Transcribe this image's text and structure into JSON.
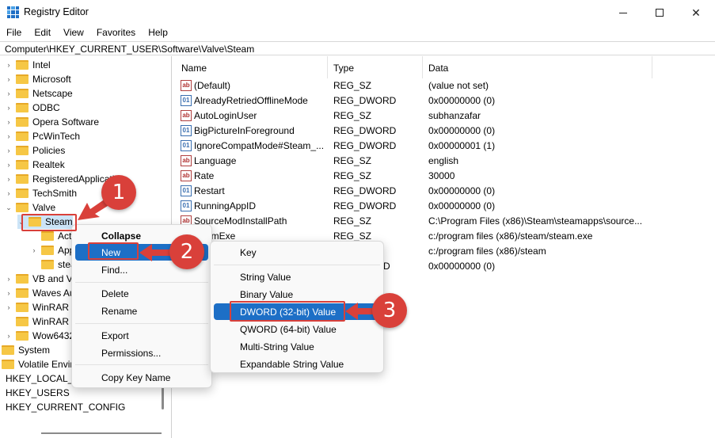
{
  "window": {
    "title": "Registry Editor",
    "minimize_icon": "minimize-icon",
    "maximize_icon": "maximize-icon",
    "close_label": "✕"
  },
  "menu": [
    "File",
    "Edit",
    "View",
    "Favorites",
    "Help"
  ],
  "address": "Computer\\HKEY_CURRENT_USER\\Software\\Valve\\Steam",
  "tree": [
    {
      "label": "Intel",
      "chevron": "›"
    },
    {
      "label": "Microsoft",
      "chevron": "›"
    },
    {
      "label": "Netscape",
      "chevron": "›"
    },
    {
      "label": "ODBC",
      "chevron": "›"
    },
    {
      "label": "Opera Software",
      "chevron": "›"
    },
    {
      "label": "PcWinTech",
      "chevron": "›"
    },
    {
      "label": "Policies",
      "chevron": "›"
    },
    {
      "label": "Realtek",
      "chevron": "›"
    },
    {
      "label": "RegisteredApplicatio",
      "chevron": "›"
    },
    {
      "label": "TechSmith",
      "chevron": "›"
    },
    {
      "label": "Valve",
      "chevron": "⌄"
    },
    {
      "label": "Steam",
      "chevron": "⌄"
    },
    {
      "label": "Act",
      "chevron": ""
    },
    {
      "label": "App",
      "chevron": "›"
    },
    {
      "label": "stea",
      "chevron": ""
    },
    {
      "label": "VB and VE",
      "chevron": "›"
    },
    {
      "label": "Waves Au",
      "chevron": "›"
    },
    {
      "label": "WinRAR",
      "chevron": "›"
    },
    {
      "label": "WinRAR S",
      "chevron": ""
    },
    {
      "label": "Wow6432",
      "chevron": "›"
    },
    {
      "label": "System",
      "chevron": ""
    },
    {
      "label": "Volatile Envir",
      "chevron": ""
    },
    {
      "label": "HKEY_LOCAL_M",
      "chevron": ""
    },
    {
      "label": "HKEY_USERS",
      "chevron": ""
    },
    {
      "label": "HKEY_CURRENT_CONFIG",
      "chevron": ""
    }
  ],
  "columns": {
    "name": "Name",
    "type": "Type",
    "data": "Data"
  },
  "values": [
    {
      "name": "(Default)",
      "type": "REG_SZ",
      "data": "(value not set)",
      "icon": "ab"
    },
    {
      "name": "AlreadyRetriedOfflineMode",
      "type": "REG_DWORD",
      "data": "0x00000000 (0)",
      "icon": "bin"
    },
    {
      "name": "AutoLoginUser",
      "type": "REG_SZ",
      "data": "subhanzafar",
      "icon": "ab"
    },
    {
      "name": "BigPictureInForeground",
      "type": "REG_DWORD",
      "data": "0x00000000 (0)",
      "icon": "bin"
    },
    {
      "name": "IgnoreCompatMode#Steam_...",
      "type": "REG_DWORD",
      "data": "0x00000001 (1)",
      "icon": "bin"
    },
    {
      "name": "Language",
      "type": "REG_SZ",
      "data": "english",
      "icon": "ab"
    },
    {
      "name": "Rate",
      "type": "REG_SZ",
      "data": "30000",
      "icon": "ab"
    },
    {
      "name": "Restart",
      "type": "REG_DWORD",
      "data": "0x00000000 (0)",
      "icon": "bin"
    },
    {
      "name": "RunningAppID",
      "type": "REG_DWORD",
      "data": "0x00000000 (0)",
      "icon": "bin"
    },
    {
      "name": "SourceModInstallPath",
      "type": "REG_SZ",
      "data": "C:\\Program Files (x86)\\Steam\\steamapps\\source...",
      "icon": "ab"
    },
    {
      "name": "amExe",
      "type": "REG_SZ",
      "data": "c:/program files (x86)/steam/steam.exe",
      "icon": "ab"
    },
    {
      "name": "",
      "type": "",
      "data": "c:/program files (x86)/steam",
      "icon": ""
    },
    {
      "name": "",
      "type": "D",
      "data": "0x00000000 (0)",
      "icon": ""
    }
  ],
  "context_menu_1": {
    "collapse": "Collapse",
    "new": "New",
    "find": "Find...",
    "delete": "Delete",
    "rename": "Rename",
    "export": "Export",
    "permissions": "Permissions...",
    "copy_key_name": "Copy Key Name",
    "submenu_chevron": "›"
  },
  "context_menu_2": {
    "key": "Key",
    "string_value": "String Value",
    "binary_value": "Binary Value",
    "dword_value": "DWORD (32-bit) Value",
    "qword_value": "QWORD (64-bit) Value",
    "multi_string_value": "Multi-String Value",
    "expandable_string_value": "Expandable String Value"
  },
  "callouts": [
    "1",
    "2",
    "3"
  ],
  "colors": {
    "highlight": "#1d6fc6",
    "callout_red": "#d9403a",
    "folder": "#f6c745"
  }
}
